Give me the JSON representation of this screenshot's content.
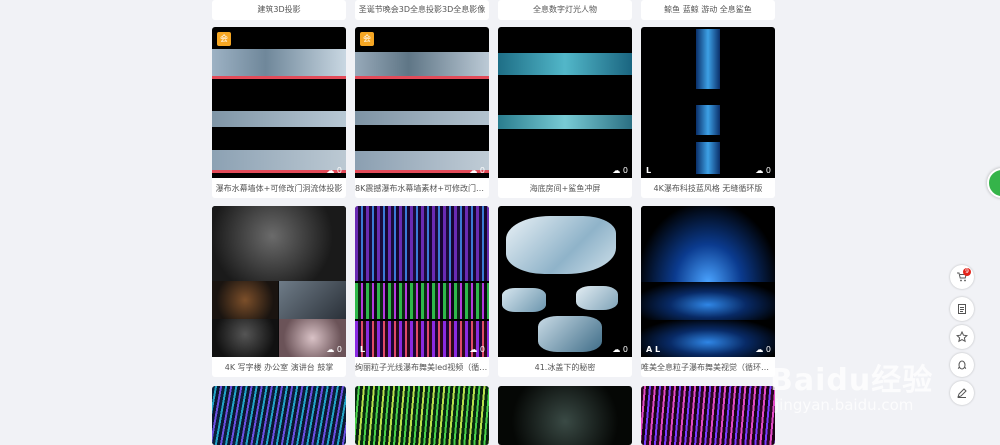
{
  "top_row": [
    {
      "caption": "建筑3D投影"
    },
    {
      "caption": "圣诞节晚会3D全息投影3D全息影像"
    },
    {
      "caption": "全息数字灯光人物"
    },
    {
      "caption": "鲸鱼 蓝鲸 游动 全息鲨鱼"
    }
  ],
  "row1": [
    {
      "caption": "瀑布水幕墙体+可修改门洞流体投影",
      "downloads": "0",
      "vip": "会"
    },
    {
      "caption": "8K震撼瀑布水幕墙素材+可修改门洞...",
      "downloads": "0",
      "vip": "会"
    },
    {
      "caption": "海底房间+鲨鱼冲屏",
      "downloads": "0"
    },
    {
      "caption": "4K瀑布科技蓝风格 无缝循环版",
      "downloads": "0",
      "mark": "L"
    }
  ],
  "row2": [
    {
      "caption": "4K 写字楼 办公室 演讲台 鼓掌",
      "downloads": "0"
    },
    {
      "caption": "绚丽粒子光线瀑布舞美led视频（循环）",
      "downloads": "0",
      "mark": "L"
    },
    {
      "caption": "41.冰盖下的秘密",
      "downloads": "0"
    },
    {
      "caption": "唯美全息粒子瀑布舞美视觉（循环遇...",
      "downloads": "0",
      "mark": "A L"
    }
  ],
  "watermark": {
    "logo": "Baidu经验",
    "url": "jingyan.baidu.com"
  },
  "sidebar": [
    {
      "icon": "cart-icon",
      "badge": "9"
    },
    {
      "icon": "document-icon"
    },
    {
      "icon": "star-icon"
    },
    {
      "icon": "qq-icon"
    },
    {
      "icon": "edit-icon"
    }
  ]
}
